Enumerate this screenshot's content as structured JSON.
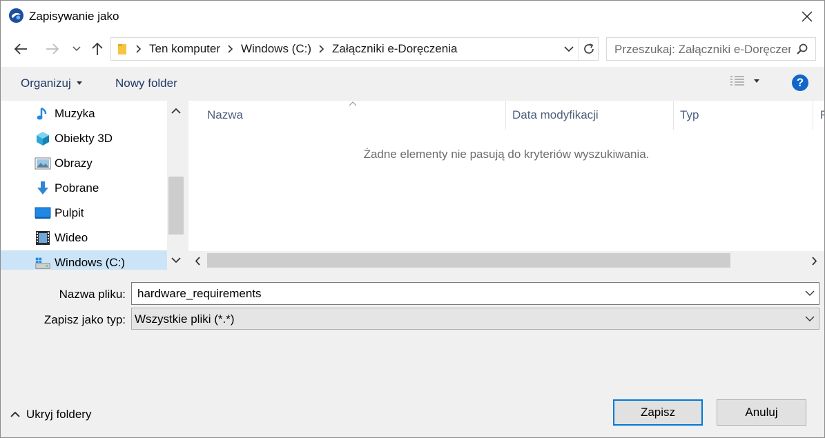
{
  "window": {
    "title": "Zapisywanie jako",
    "close_glyph": "✕"
  },
  "navigation": {
    "back_icon": "arrow-left-icon",
    "forward_icon": "arrow-right-icon",
    "recent_icon": "chevron-down-icon",
    "up_icon": "arrow-up-icon"
  },
  "address_bar": {
    "breadcrumbs": [
      "Ten komputer",
      "Windows (C:)",
      "Załączniki e-Doręczenia"
    ]
  },
  "search": {
    "placeholder": "Przeszukaj: Załączniki e-Doręczenia"
  },
  "toolbar": {
    "organize_label": "Organizuj",
    "new_folder_label": "Nowy folder",
    "help_label": "?"
  },
  "nav_pane": {
    "items": [
      {
        "label": "Muzyka",
        "icon": "music-icon"
      },
      {
        "label": "Obiekty 3D",
        "icon": "cube-icon"
      },
      {
        "label": "Obrazy",
        "icon": "pictures-icon"
      },
      {
        "label": "Pobrane",
        "icon": "download-icon"
      },
      {
        "label": "Pulpit",
        "icon": "desktop-icon"
      },
      {
        "label": "Wideo",
        "icon": "video-icon"
      },
      {
        "label": "Windows (C:)",
        "icon": "drive-icon",
        "selected": true
      }
    ]
  },
  "file_list": {
    "columns": [
      "Nazwa",
      "Data modyfikacji",
      "Typ",
      "R"
    ],
    "empty_message": "Żadne elementy nie pasują do kryteriów wyszukiwania."
  },
  "form": {
    "filename_label": "Nazwa pliku:",
    "filename_value": "hardware_requirements",
    "filetype_label": "Zapisz jako typ:",
    "filetype_value": "Wszystkie pliki (*.*)"
  },
  "footer": {
    "hide_folders_label": "Ukryj foldery",
    "save_label": "Zapisz",
    "cancel_label": "Anuluj"
  },
  "colors": {
    "accent": "#0078d7",
    "help": "#1167c9",
    "selected_nav": "#cce4f7"
  }
}
